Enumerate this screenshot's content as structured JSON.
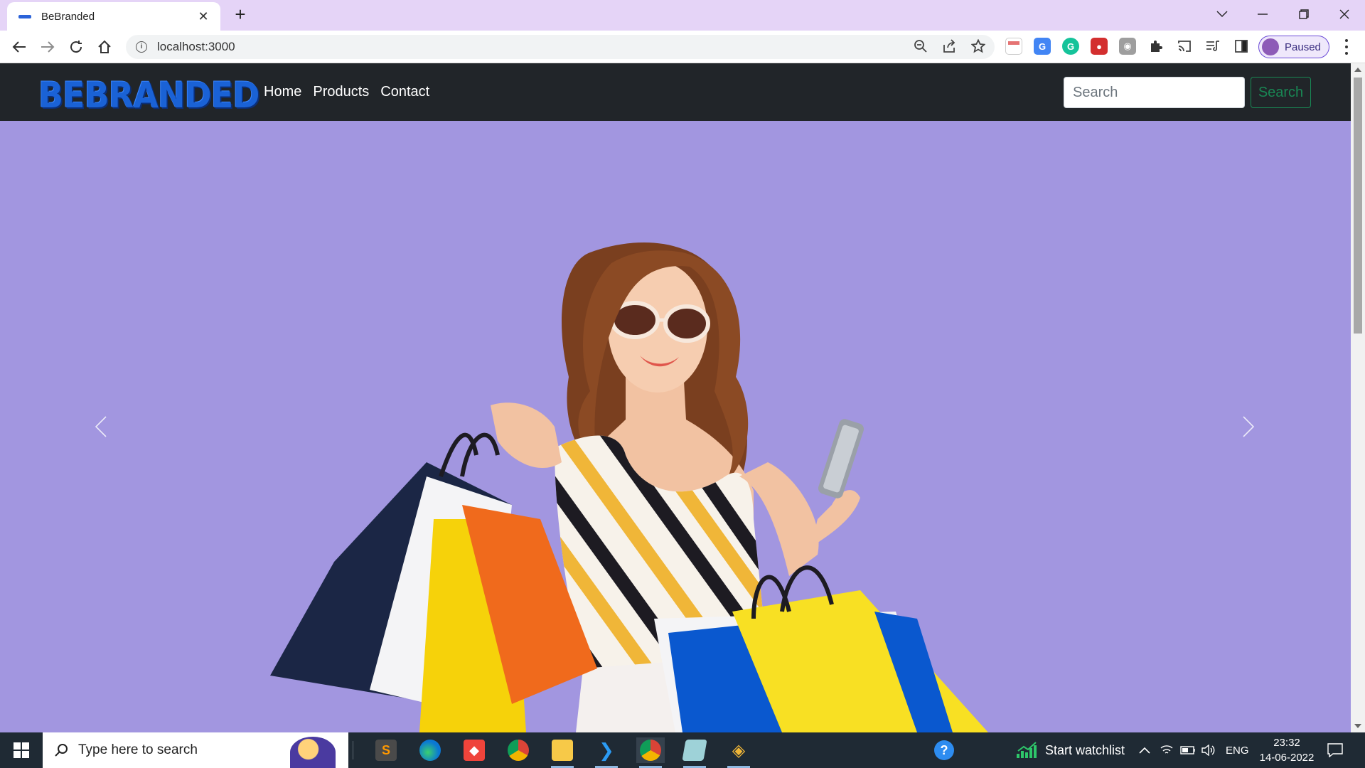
{
  "browser": {
    "tab_title": "BeBranded",
    "url": "localhost:3000",
    "profile_label": "Paused"
  },
  "site": {
    "brand": "BEBRANDED",
    "nav": [
      {
        "label": "Home"
      },
      {
        "label": "Products"
      },
      {
        "label": "Contact"
      }
    ],
    "search_placeholder": "Search",
    "search_button": "Search",
    "colors": {
      "navbar_bg": "#212529",
      "hero_bg": "#a296e0",
      "brand": "#1a62d6",
      "search_button": "#198754"
    }
  },
  "taskbar": {
    "search_placeholder": "Type here to search",
    "watchlist_label": "Start watchlist",
    "language": "ENG",
    "time": "23:32",
    "date": "14-06-2022"
  }
}
